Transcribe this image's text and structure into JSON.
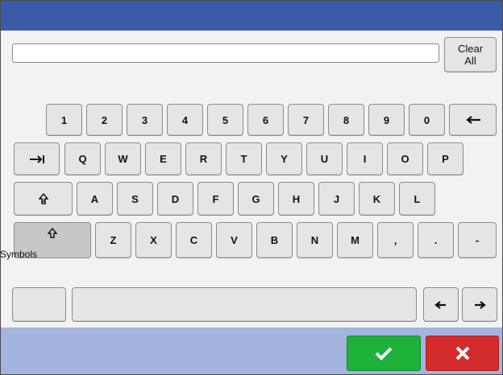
{
  "text_input": {
    "value": ""
  },
  "clear_all": {
    "line1": "Clear",
    "line2": "All"
  },
  "rows": {
    "numbers": [
      "1",
      "2",
      "3",
      "4",
      "5",
      "6",
      "7",
      "8",
      "9",
      "0"
    ],
    "top": [
      "Q",
      "W",
      "E",
      "R",
      "T",
      "Y",
      "U",
      "I",
      "O",
      "P"
    ],
    "middle": [
      "A",
      "S",
      "D",
      "F",
      "G",
      "H",
      "J",
      "K",
      "L"
    ],
    "bottom": [
      "Z",
      "X",
      "C",
      "V",
      "B",
      "N",
      "M",
      ",",
      ".",
      "-"
    ]
  },
  "icons": {
    "backspace": "left-arrow-icon",
    "tab": "tab-arrow-icon",
    "caps_lock": "caps-lock-icon",
    "shift": "shift-arrow-icon",
    "cursor_left": "left-arrow-icon",
    "cursor_right": "right-arrow-icon",
    "confirm": "checkmark-icon",
    "cancel": "x-icon"
  },
  "symbols_label": "Symbols",
  "colors": {
    "title_bar": "#3a5ba8",
    "footer_bar": "#a3b4de",
    "confirm": "#1fb23a",
    "cancel": "#d42c2c",
    "key_fill": "#e5e5e5"
  }
}
